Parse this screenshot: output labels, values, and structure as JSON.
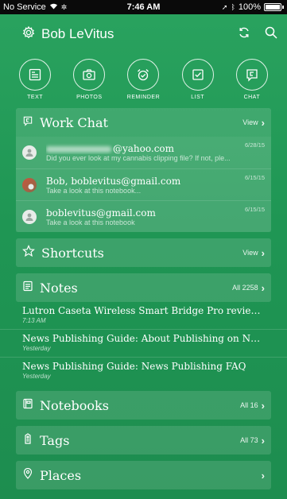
{
  "status_bar": {
    "carrier": "No Service",
    "time": "7:46 AM",
    "battery": "100%"
  },
  "header": {
    "user_name": "Bob LeVitus"
  },
  "actions": [
    {
      "label": "TEXT",
      "icon": "text-note-icon"
    },
    {
      "label": "PHOTOS",
      "icon": "camera-icon"
    },
    {
      "label": "REMINDER",
      "icon": "alarm-clock-icon"
    },
    {
      "label": "LIST",
      "icon": "checkbox-icon"
    },
    {
      "label": "CHAT",
      "icon": "chat-icon"
    }
  ],
  "work_chat": {
    "title": "Work Chat",
    "action": "View",
    "items": [
      {
        "name": "@yahoo.com",
        "preview": "Did you ever look at my cannabis clipping file? If not, ple...",
        "date": "6/28/15"
      },
      {
        "name": "Bob, boblevitus@gmail.com",
        "preview": "Take a look at this notebook...",
        "date": "6/15/15"
      },
      {
        "name": "boblevitus@gmail.com",
        "preview": "Take a look at this notebook",
        "date": "6/15/15"
      }
    ]
  },
  "shortcuts": {
    "title": "Shortcuts",
    "action": "View"
  },
  "notes": {
    "title": "Notes",
    "action": "All 2258",
    "items": [
      {
        "title": "Lutron Caseta Wireless Smart Bridge Pro review:...",
        "meta": "7:13 AM"
      },
      {
        "title": "News Publishing Guide: About Publishing on Ne...",
        "meta": "Yesterday"
      },
      {
        "title": "News Publishing Guide: News Publishing FAQ",
        "meta": "Yesterday"
      }
    ]
  },
  "notebooks": {
    "title": "Notebooks",
    "action": "All 16"
  },
  "tags": {
    "title": "Tags",
    "action": "All 73"
  },
  "places": {
    "title": "Places",
    "action": ""
  },
  "colors": {
    "background": "#1f9654",
    "status_bar": "#0a0a0a",
    "text": "#ffffff"
  }
}
